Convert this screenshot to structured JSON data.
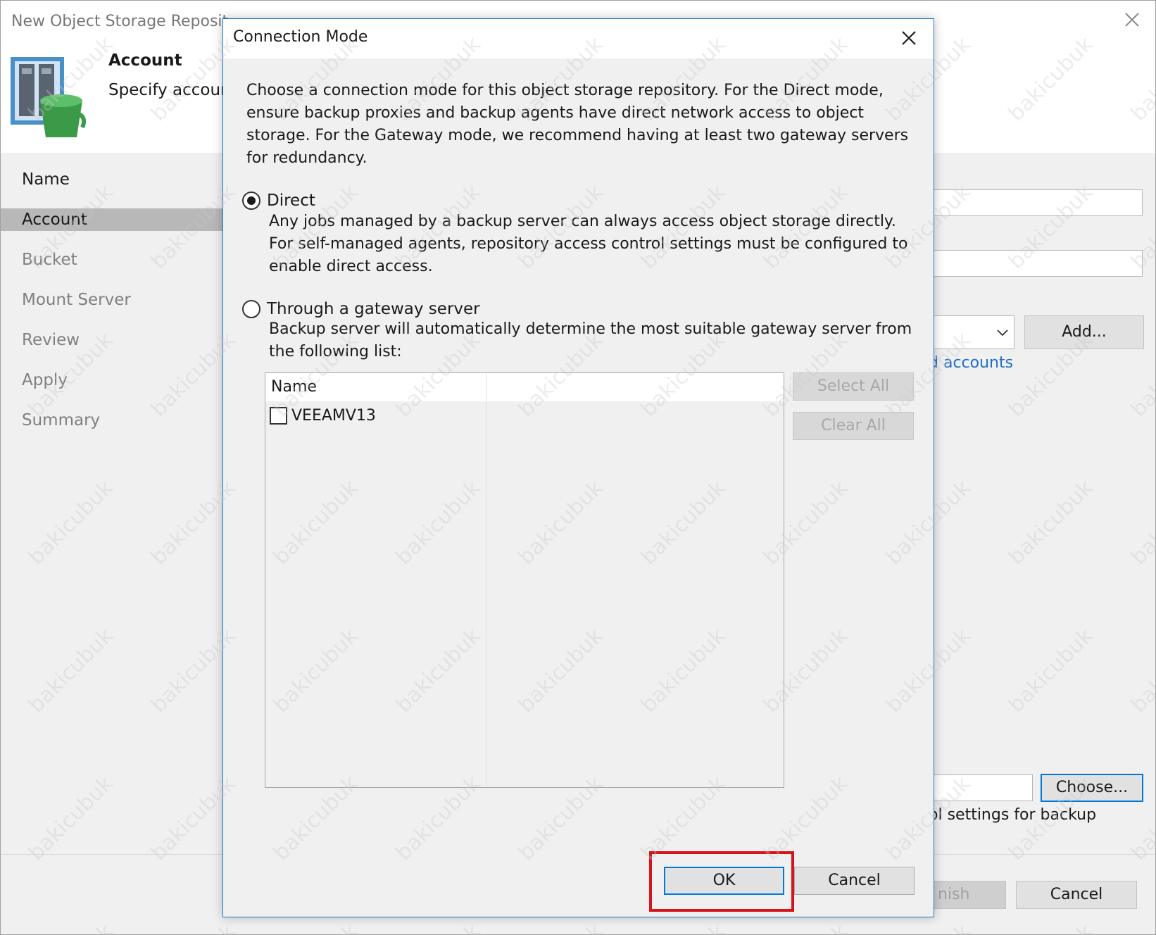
{
  "wizard": {
    "title": "New Object Storage Reposit",
    "header_title": "Account",
    "header_subtitle": "Specify accoun",
    "steps": [
      {
        "label": "Name",
        "state": "done"
      },
      {
        "label": "Account",
        "state": "active"
      },
      {
        "label": "Bucket",
        "state": "pending"
      },
      {
        "label": "Mount Server",
        "state": "pending"
      },
      {
        "label": "Review",
        "state": "pending"
      },
      {
        "label": "Apply",
        "state": "pending"
      },
      {
        "label": "Summary",
        "state": "pending"
      }
    ],
    "add_button": "Add...",
    "accounts_link": "d accounts",
    "choose_button": "Choose...",
    "settings_text": "ol settings for backup",
    "finish_button": "nish",
    "cancel_button": "Cancel"
  },
  "dialog": {
    "title": "Connection Mode",
    "description": "Choose a connection mode for this object storage repository. For the Direct mode, ensure backup proxies and backup agents have direct network access to object storage. For the Gateway mode, we recommend having at least two gateway servers for redundancy.",
    "direct": {
      "label": "Direct",
      "selected": true,
      "help": "Any jobs managed by a backup server can always access object storage directly. For self-managed agents, repository access control settings must be configured to enable direct access."
    },
    "gateway": {
      "label": "Through a gateway server",
      "selected": false,
      "help": "Backup server will automatically determine the most suitable gateway server from the following list:"
    },
    "server_list": {
      "header": "Name",
      "rows": [
        {
          "label": "VEEAMV13",
          "checked": false
        }
      ]
    },
    "select_all_button": "Select All",
    "clear_all_button": "Clear All",
    "ok_button": "OK",
    "cancel_button": "Cancel"
  },
  "watermark_text": "bakicubuk"
}
